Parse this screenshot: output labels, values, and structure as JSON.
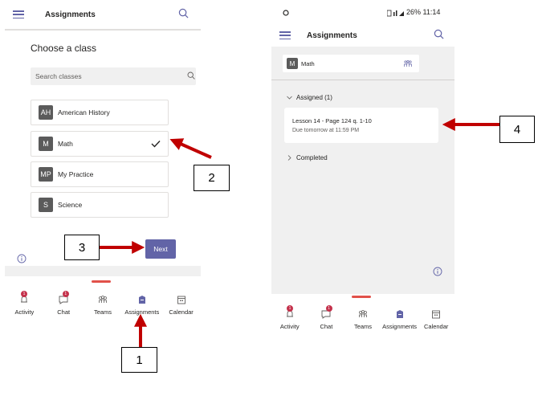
{
  "left_phone": {
    "header": {
      "title": "Assignments"
    },
    "choose_title": "Choose a class",
    "search": {
      "placeholder": "Search classes"
    },
    "classes": [
      {
        "initials": "AH",
        "name": "American History",
        "selected": false
      },
      {
        "initials": "M",
        "name": "Math",
        "selected": true
      },
      {
        "initials": "MP",
        "name": "My Practice",
        "selected": false
      },
      {
        "initials": "S",
        "name": "Science",
        "selected": false
      }
    ],
    "next_label": "Next",
    "tabs": [
      {
        "label": "Activity",
        "icon": "bell-icon",
        "badge": "1"
      },
      {
        "label": "Chat",
        "icon": "chat-icon",
        "badge": "1"
      },
      {
        "label": "Teams",
        "icon": "teams-icon"
      },
      {
        "label": "Assignments",
        "icon": "assignments-icon"
      },
      {
        "label": "Calendar",
        "icon": "calendar-icon"
      }
    ]
  },
  "right_phone": {
    "status_bar": {
      "right": "26% 11:14"
    },
    "header": {
      "title": "Assignments"
    },
    "class_chip": {
      "initials": "M",
      "name": "Math"
    },
    "assigned_section": "Assigned (1)",
    "assignment": {
      "title": "Lesson 14 - Page 124 q. 1-10",
      "due": "Due tomorrow at 11:59 PM"
    },
    "completed_section": "Completed",
    "tabs": [
      {
        "label": "Activity",
        "icon": "bell-icon",
        "badge": "1"
      },
      {
        "label": "Chat",
        "icon": "chat-icon",
        "badge": "1"
      },
      {
        "label": "Teams",
        "icon": "teams-icon"
      },
      {
        "label": "Assignments",
        "icon": "assignments-icon"
      },
      {
        "label": "Calendar",
        "icon": "calendar-icon"
      }
    ]
  },
  "callouts": [
    "1",
    "2",
    "3",
    "4"
  ],
  "colors": {
    "accent": "#6264a7",
    "arrow": "#c00000",
    "badge": "#c4314b",
    "band": "#f0f0f0"
  }
}
